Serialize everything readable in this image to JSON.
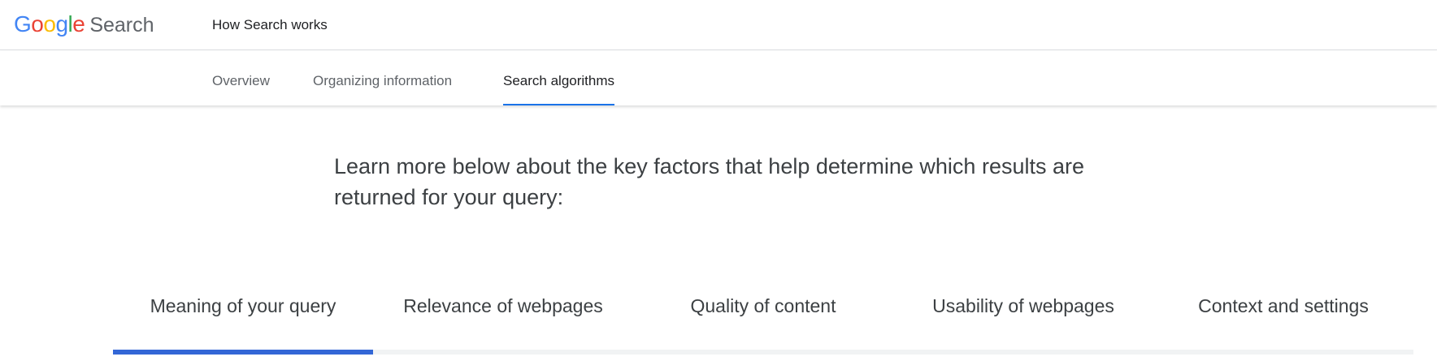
{
  "header": {
    "logo_letters": [
      {
        "ch": "G",
        "color": "#4285F4"
      },
      {
        "ch": "o",
        "color": "#EA4335"
      },
      {
        "ch": "o",
        "color": "#FBBC05"
      },
      {
        "ch": "g",
        "color": "#4285F4"
      },
      {
        "ch": "l",
        "color": "#34A853"
      },
      {
        "ch": "e",
        "color": "#EA4335"
      }
    ],
    "product": "Search",
    "site_title": "How Search works"
  },
  "subnav": {
    "tabs": [
      {
        "label": "Overview",
        "active": false
      },
      {
        "label": "Organizing information",
        "active": false
      },
      {
        "label": "Search algorithms",
        "active": true
      }
    ],
    "accent": "#1a73e8"
  },
  "main": {
    "headline": "Learn more below about the key factors that help determine which results are returned for your query:"
  },
  "factors": {
    "tabs": [
      {
        "label": "Meaning of your query",
        "active": true
      },
      {
        "label": "Relevance of webpages",
        "active": false
      },
      {
        "label": "Quality of content",
        "active": false
      },
      {
        "label": "Usability of webpages",
        "active": false
      },
      {
        "label": "Context and settings",
        "active": false
      }
    ],
    "progress_color": "#3367d6",
    "track_color": "#f1f3f4"
  }
}
